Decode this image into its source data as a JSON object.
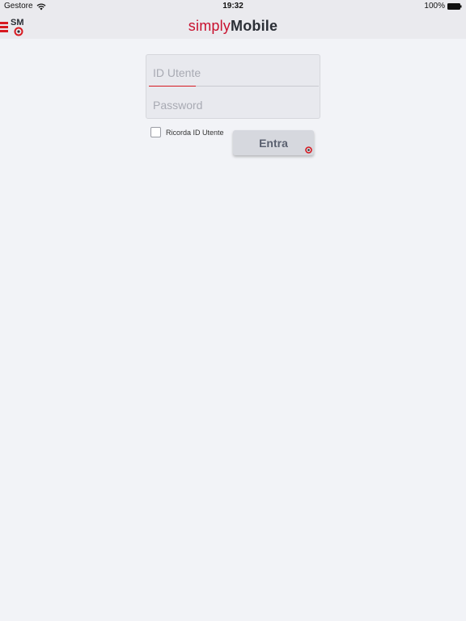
{
  "status_bar": {
    "carrier": "Gestore",
    "time": "19:32",
    "battery": "100%"
  },
  "header": {
    "logo_text": "SM",
    "brand_part1": "simply",
    "brand_part2": "Mobile"
  },
  "login": {
    "username_placeholder": "ID Utente",
    "password_placeholder": "Password",
    "remember_label": "Ricorda ID Utente",
    "submit_label": "Entra"
  },
  "colors": {
    "accent": "#d71920",
    "background": "#f2f3f7"
  },
  "icons": [
    "wifi-icon",
    "battery-icon",
    "menu-icon",
    "sm-logo-icon",
    "target-icon"
  ]
}
